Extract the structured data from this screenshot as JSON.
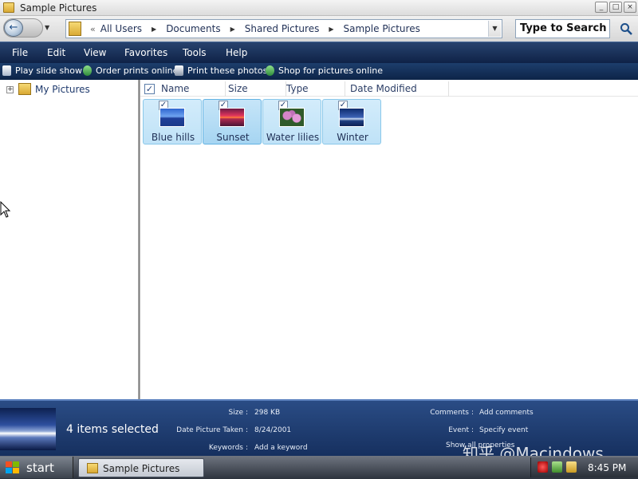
{
  "window": {
    "title": "Sample Pictures",
    "buttons": {
      "minimize": "_",
      "maximize": "□",
      "close": "×"
    }
  },
  "address": {
    "back_glyph": "←",
    "dropdown_glyph": "▼",
    "chevron": "«",
    "crumbs": [
      "All Users",
      "Documents",
      "Shared Pictures",
      "Sample Pictures"
    ],
    "crumb_arrow": "▶",
    "search_placeholder": "Type to Search"
  },
  "menu": [
    "File",
    "Edit",
    "View",
    "Favorites",
    "Tools",
    "Help"
  ],
  "commands": [
    {
      "label": "Play slide show",
      "icon": "slideshow-icon"
    },
    {
      "label": "Order prints online",
      "icon": "order-prints-icon"
    },
    {
      "label": "Print these photos",
      "icon": "print-icon"
    },
    {
      "label": "Shop for pictures online",
      "icon": "shop-icon"
    }
  ],
  "tree": {
    "expand": "+",
    "item": "My Pictures"
  },
  "columns": [
    "Name",
    "Size",
    "Type",
    "Date Modified"
  ],
  "files": [
    {
      "name": "Blue hills",
      "check": "✓"
    },
    {
      "name": "Sunset",
      "check": "✓"
    },
    {
      "name": "Water lilies",
      "check": "✓"
    },
    {
      "name": "Winter",
      "check": "✓"
    }
  ],
  "details": {
    "selection": "4 items selected",
    "fields": [
      {
        "label": "Size",
        "value": "298 KB"
      },
      {
        "label": "Date Picture Taken",
        "value": "8/24/2001"
      },
      {
        "label": "Keywords",
        "value": "Add a keyword"
      },
      {
        "label": "Comments",
        "value": "Add comments"
      },
      {
        "label": "Event",
        "value": "Specify event"
      },
      {
        "label": "Show all properties",
        "value": ""
      }
    ],
    "watermark": "知乎 @Macindows"
  },
  "taskbar": {
    "start": "start",
    "window_item": "Sample Pictures",
    "clock": "8:45 PM"
  },
  "colors": {
    "menubar": "#1a3360",
    "tile": "#bfe2f7",
    "details": "#1f3c70",
    "taskbar": "#3b424c"
  }
}
